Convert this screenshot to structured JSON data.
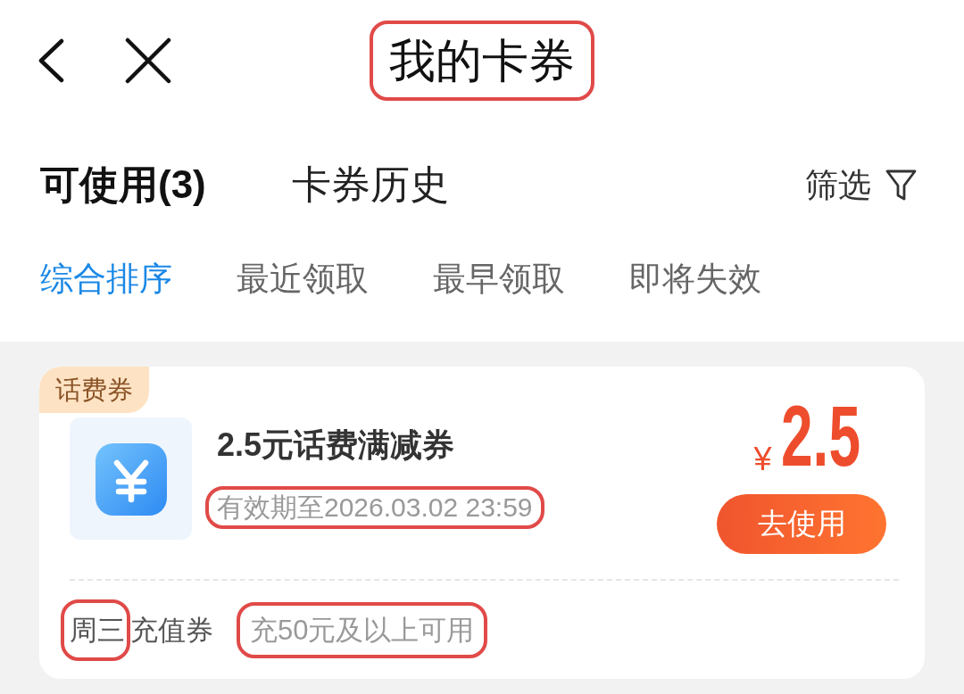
{
  "header": {
    "title": {
      "text": "我的卡券",
      "annotated": true
    }
  },
  "tabs": [
    {
      "label": "可使用(3)",
      "selected": true
    },
    {
      "label": "卡券历史",
      "selected": false
    }
  ],
  "filter": {
    "label": "筛选"
  },
  "sort_options": [
    {
      "label": "综合排序",
      "selected": true
    },
    {
      "label": "最近领取",
      "selected": false
    },
    {
      "label": "最早领取",
      "selected": false
    },
    {
      "label": "即将失效",
      "selected": false
    }
  ],
  "coupons": [
    {
      "tag": "话费券",
      "title": "2.5元话费满减券",
      "expiry": {
        "text": "有效期至2026.03.02 23:59",
        "annotated": true
      },
      "currency": "¥",
      "amount": "2.5",
      "action": "去使用",
      "category": [
        {
          "text": "周三",
          "annotated": true
        },
        {
          "text": "充值券",
          "annotated": false
        }
      ],
      "condition": {
        "text": "充50元及以上可用",
        "annotated": true
      }
    }
  ]
}
